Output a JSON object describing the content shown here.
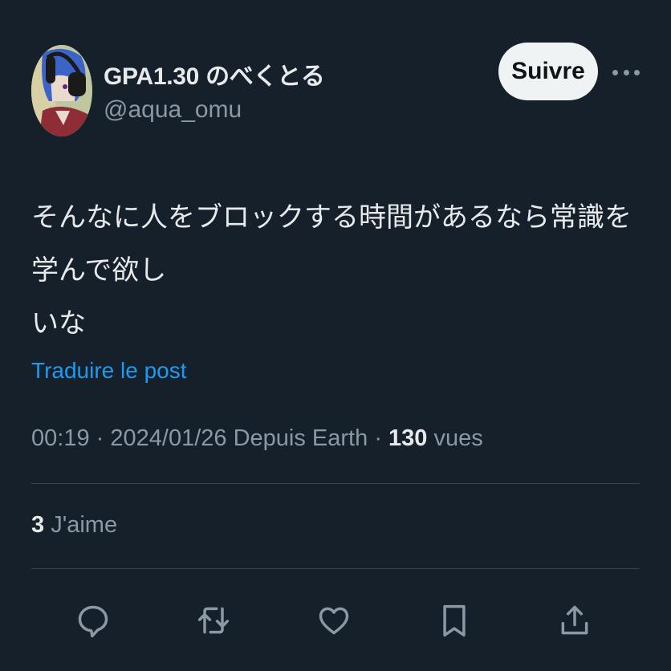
{
  "author": {
    "display_name": "GPA1.30 のべくとる",
    "handle": "@aqua_omu"
  },
  "header": {
    "follow_label": "Suivre"
  },
  "tweet": {
    "text": "そんなに人をブロックする時間があるなら常識を学んで欲し\nいな",
    "translate_label": "Traduire le post"
  },
  "meta": {
    "time": "00:19",
    "separator": "·",
    "date": "2024/01/26",
    "source": "Depuis Earth",
    "views_count": "130",
    "views_label": "vues"
  },
  "stats": {
    "likes_count": "3",
    "likes_label": "J'aime"
  },
  "actions": [
    "reply-icon",
    "retweet-icon",
    "like-icon",
    "bookmark-icon",
    "share-icon"
  ],
  "colors": {
    "background": "#15202b",
    "text": "#e7e9ea",
    "secondary": "#8b98a5",
    "link": "#1d9bf0",
    "divider": "#38444d",
    "follow_bg": "#eff3f4"
  }
}
